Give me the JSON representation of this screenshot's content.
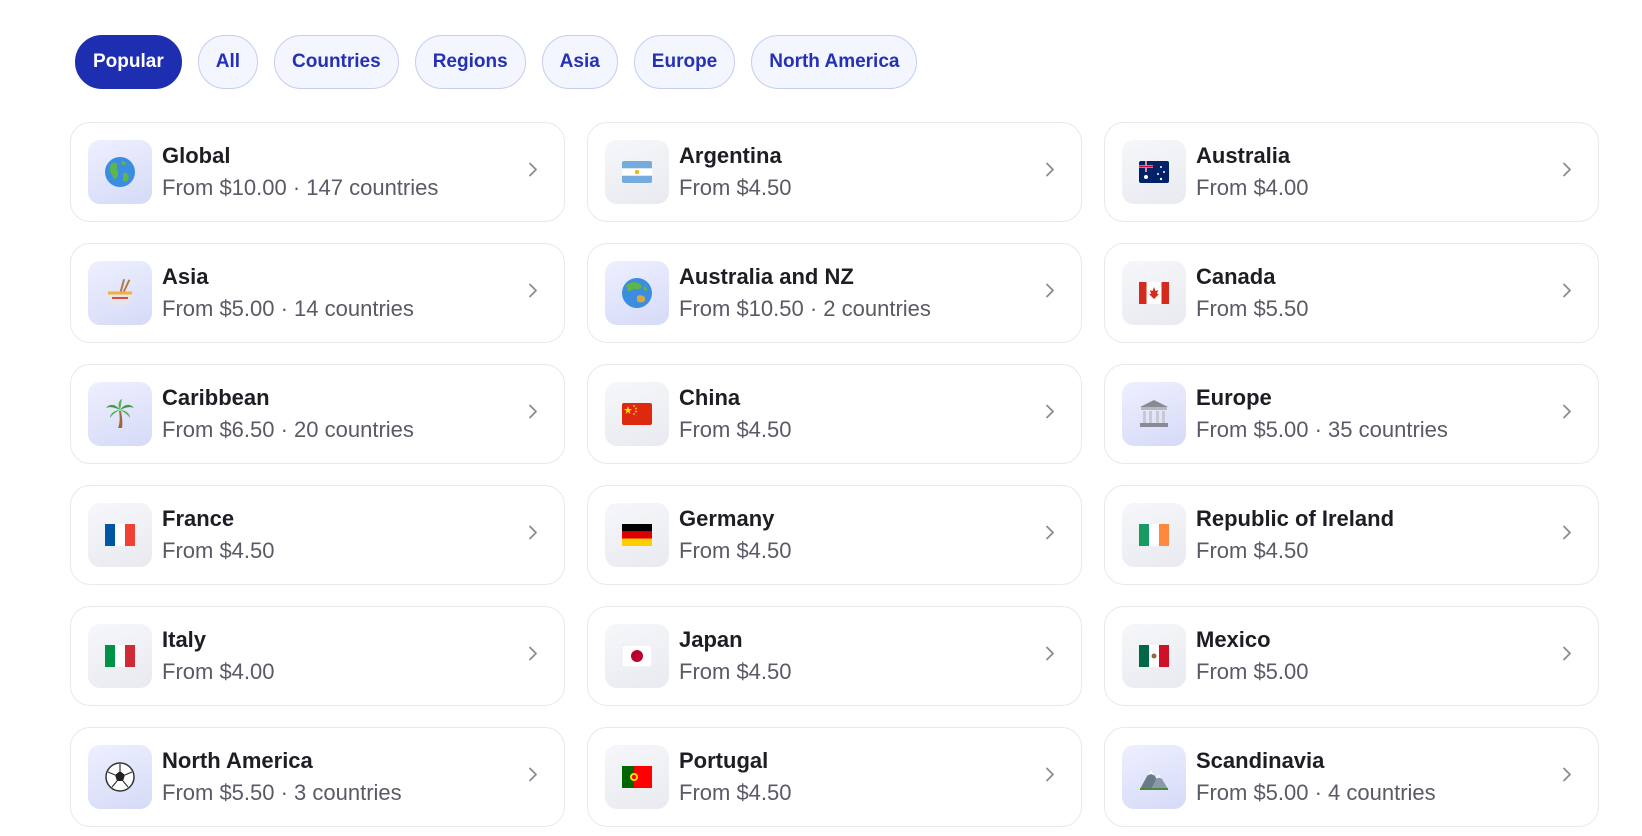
{
  "filters": [
    {
      "label": "Popular",
      "active": true
    },
    {
      "label": "All",
      "active": false
    },
    {
      "label": "Countries",
      "active": false
    },
    {
      "label": "Regions",
      "active": false
    },
    {
      "label": "Asia",
      "active": false
    },
    {
      "label": "Europe",
      "active": false
    },
    {
      "label": "North America",
      "active": false
    }
  ],
  "destinations": [
    {
      "name": "Global",
      "price": "From $10.00 · 147 countries",
      "icon": "globe-americas-icon",
      "tint": "blue"
    },
    {
      "name": "Argentina",
      "price": "From $4.50",
      "icon": "flag-argentina-icon",
      "tint": "gray"
    },
    {
      "name": "Australia",
      "price": "From $4.00",
      "icon": "flag-australia-icon",
      "tint": "gray"
    },
    {
      "name": "Asia",
      "price": "From $5.00 · 14 countries",
      "icon": "noodle-bowl-icon",
      "tint": "blue"
    },
    {
      "name": "Australia and NZ",
      "price": "From $10.50 · 2 countries",
      "icon": "globe-asia-australia-icon",
      "tint": "blue"
    },
    {
      "name": "Canada",
      "price": "From $5.50",
      "icon": "flag-canada-icon",
      "tint": "gray"
    },
    {
      "name": "Caribbean",
      "price": "From $6.50 · 20 countries",
      "icon": "palm-tree-icon",
      "tint": "blue"
    },
    {
      "name": "China",
      "price": "From $4.50",
      "icon": "flag-china-icon",
      "tint": "gray"
    },
    {
      "name": "Europe",
      "price": "From $5.00 · 35 countries",
      "icon": "classical-building-icon",
      "tint": "blue"
    },
    {
      "name": "France",
      "price": "From $4.50",
      "icon": "flag-france-icon",
      "tint": "gray"
    },
    {
      "name": "Germany",
      "price": "From $4.50",
      "icon": "flag-germany-icon",
      "tint": "gray"
    },
    {
      "name": "Republic of Ireland",
      "price": "From $4.50",
      "icon": "flag-ireland-icon",
      "tint": "gray"
    },
    {
      "name": "Italy",
      "price": "From $4.00",
      "icon": "flag-italy-icon",
      "tint": "gray"
    },
    {
      "name": "Japan",
      "price": "From $4.50",
      "icon": "flag-japan-icon",
      "tint": "gray"
    },
    {
      "name": "Mexico",
      "price": "From $5.00",
      "icon": "flag-mexico-icon",
      "tint": "gray"
    },
    {
      "name": "North America",
      "price": "From $5.50 · 3 countries",
      "icon": "soccer-ball-icon",
      "tint": "blue"
    },
    {
      "name": "Portugal",
      "price": "From $4.50",
      "icon": "flag-portugal-icon",
      "tint": "gray"
    },
    {
      "name": "Scandinavia",
      "price": "From $5.00 · 4 countries",
      "icon": "mountain-icon",
      "tint": "blue"
    }
  ],
  "colors": {
    "accent": "#1e2eb0",
    "chip_text": "#2531b4",
    "chip_bg": "#f3f5ff",
    "card_border": "#e8e9ef",
    "secondary_text": "#5a5a66"
  }
}
